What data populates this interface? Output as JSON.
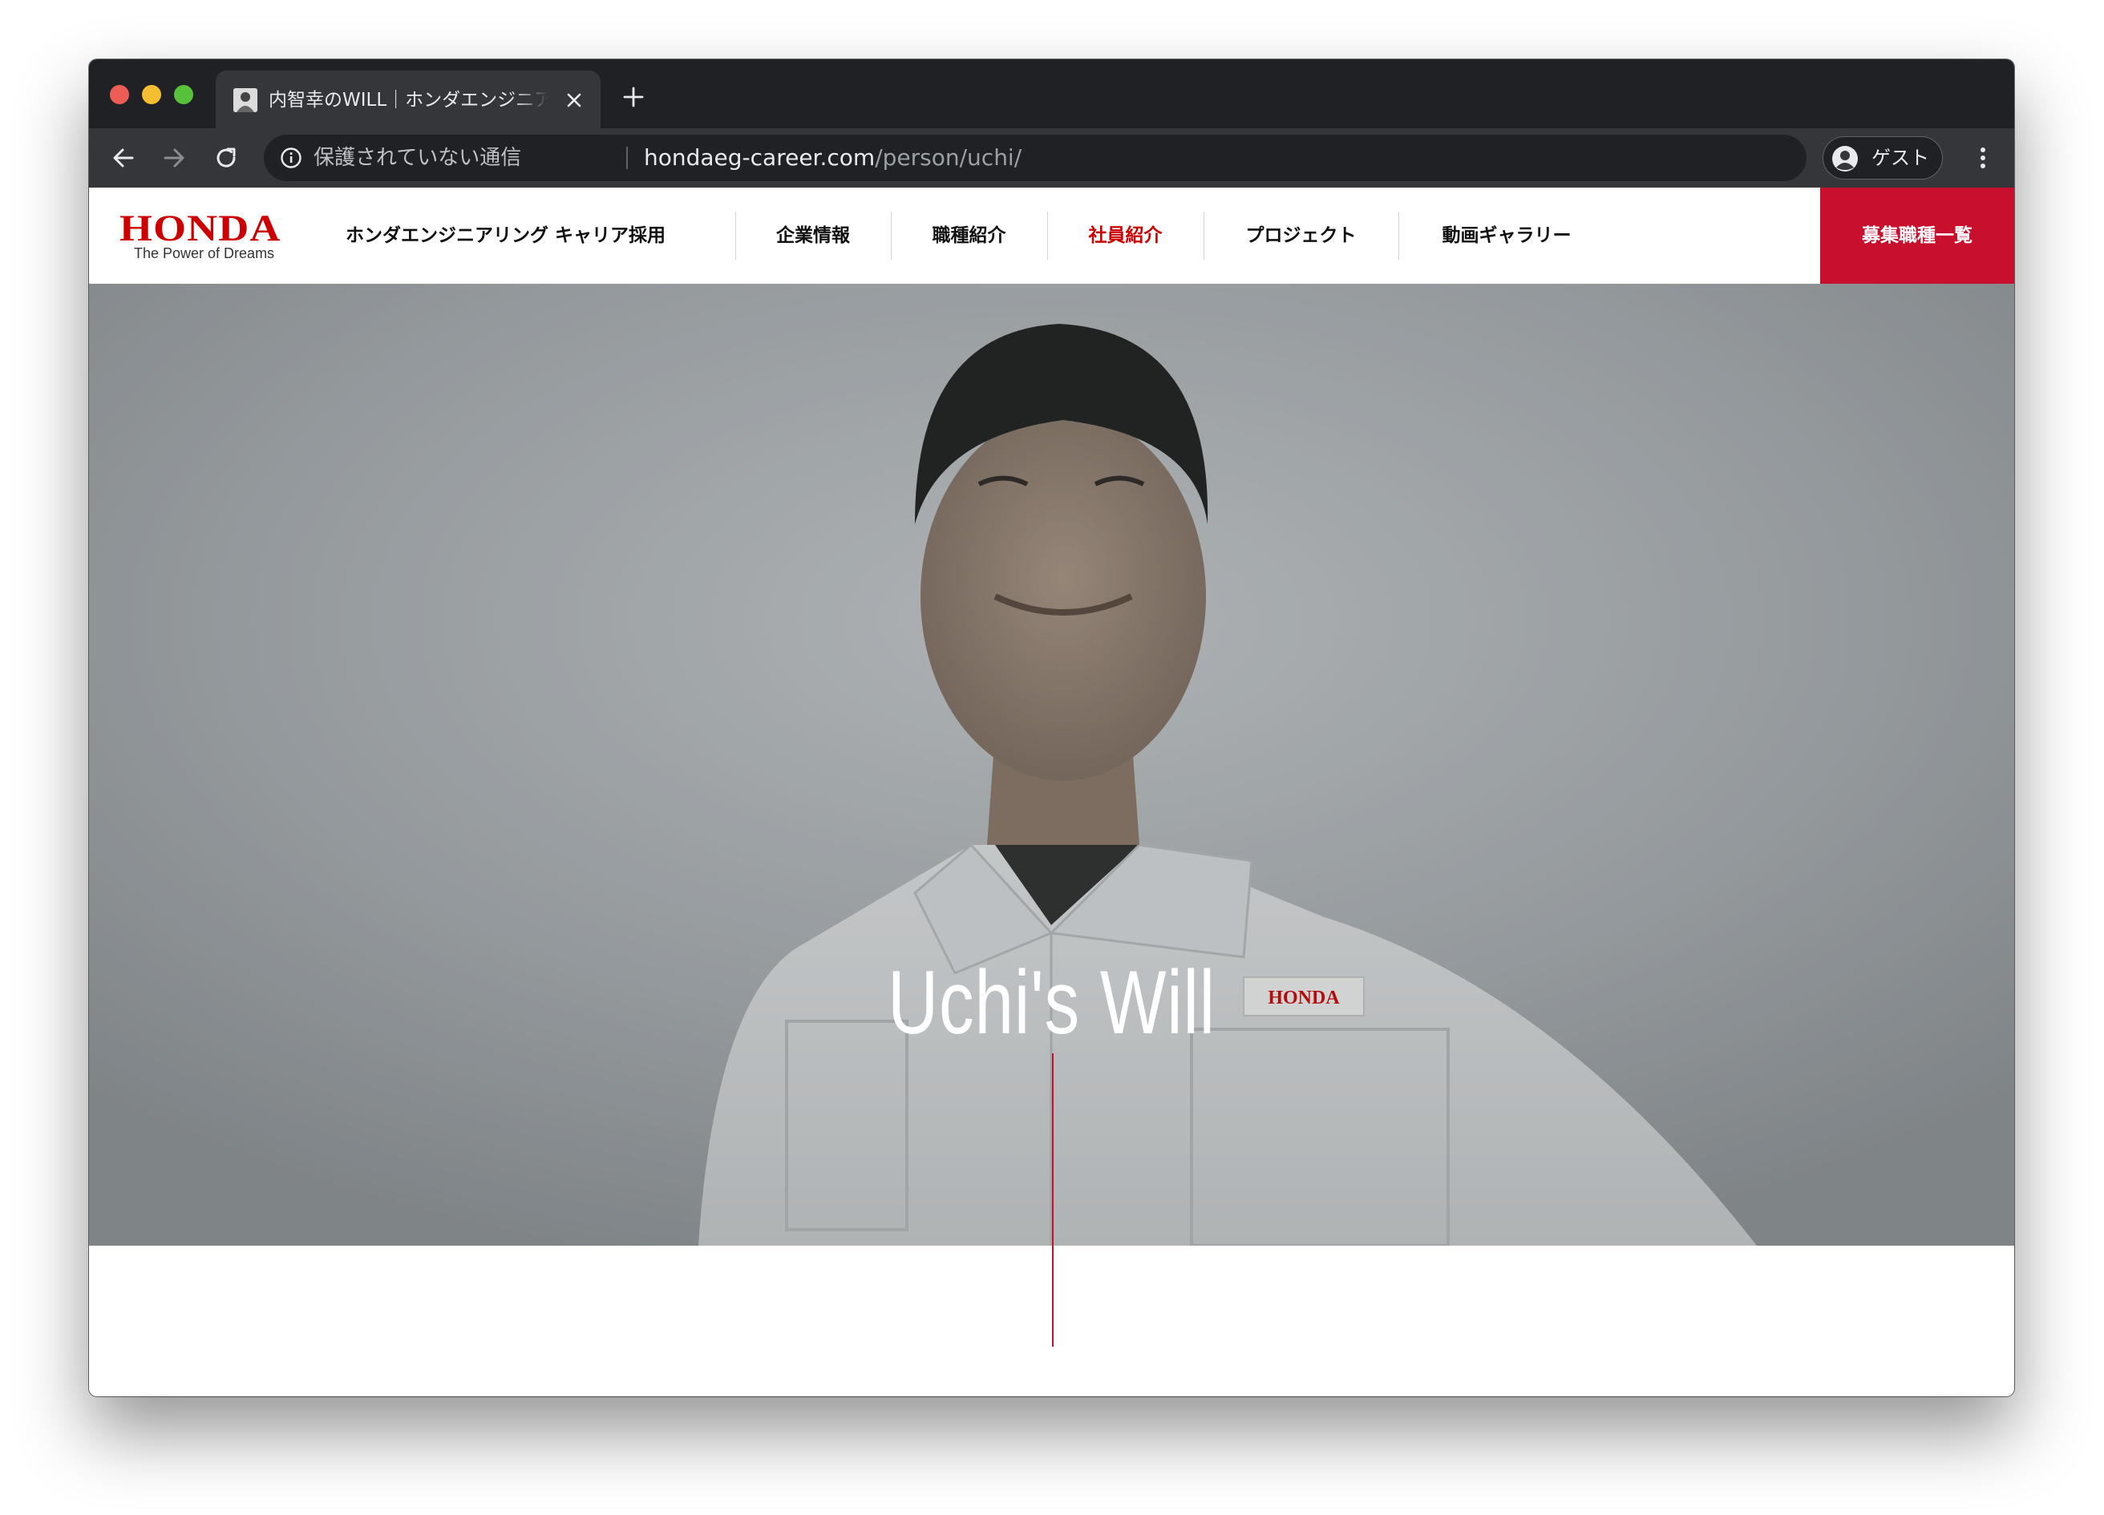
{
  "browser": {
    "tab_title": "内智幸のWILL｜ホンダエンジニアリング キャリア採用",
    "security_label": "保護されていない通信",
    "url_host": "hondaeg-career.com",
    "url_path": "/person/uchi/",
    "profile_label": "ゲスト"
  },
  "header": {
    "logo_text": "HONDA",
    "logo_tagline": "The Power of Dreams",
    "site_name": "ホンダエンジニアリング キャリア採用",
    "nav": [
      {
        "label": "企業情報",
        "active": false
      },
      {
        "label": "職種紹介",
        "active": false
      },
      {
        "label": "社員紹介",
        "active": true
      },
      {
        "label": "プロジェクト",
        "active": false
      },
      {
        "label": "動画ギャラリー",
        "active": false
      }
    ],
    "cta_label": "募集職種一覧"
  },
  "hero": {
    "title": "Uchi's Will",
    "badge_text": "HONDA"
  },
  "colors": {
    "brand_red": "#c8102e",
    "logo_red": "#cc0000",
    "chrome_dark": "#202124",
    "chrome_toolbar": "#35363a"
  }
}
